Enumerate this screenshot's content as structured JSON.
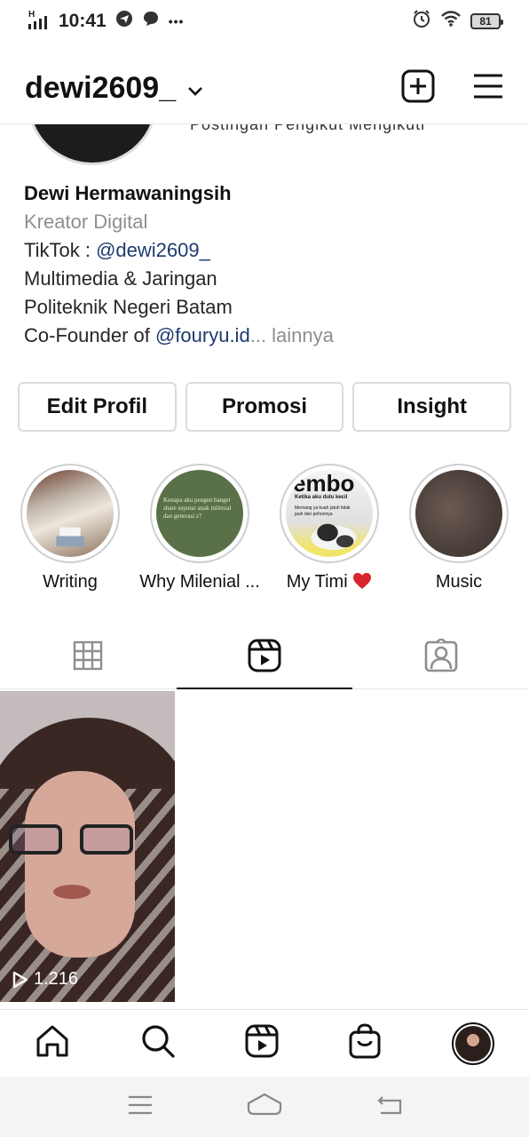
{
  "status_bar": {
    "time": "10:41",
    "dots": "•••",
    "battery": "81",
    "icons": [
      "signal-icon",
      "telegram-icon",
      "chat-bubble-icon",
      "alarm-icon",
      "wifi-icon",
      "battery-icon"
    ]
  },
  "header": {
    "username": "dewi2609_",
    "icons": [
      "chevron-down-icon",
      "new-post-icon",
      "menu-icon"
    ]
  },
  "profile": {
    "stats_partial": "Postingan    Pengikut    Mengikuti",
    "name": "Dewi Hermawaningsih",
    "category": "Kreator Digital",
    "bio_tiktok_prefix": "TikTok : ",
    "bio_tiktok_handle": "@dewi2609_",
    "bio_line2": "Multimedia & Jaringan",
    "bio_line3": "Politeknik Negeri Batam",
    "bio_cofounder_prefix": "Co-Founder of ",
    "bio_cofounder_handle": "@fouryu.id",
    "bio_ellipsis": "...",
    "more_label": "lainnya"
  },
  "actions": {
    "edit": "Edit Profil",
    "promo": "Promosi",
    "insight": "Insight"
  },
  "highlights": [
    {
      "label": "Writing"
    },
    {
      "label": "Why Milenial ...",
      "cover_text": "Kenapa aku pengen banget share seputar anak milenial dan generasi z?"
    },
    {
      "label": "My Timi",
      "cover_top": "embo",
      "cover_sub": "Ketika aku dulu kecil",
      "cover_body": "Memang ya kuah jatuh tidak jauh dari pohonnya"
    },
    {
      "label": "Music"
    }
  ],
  "tabs": [
    "grid-icon",
    "reels-icon",
    "tagged-icon"
  ],
  "reel": {
    "views": "1.216"
  },
  "bottom_nav": [
    "home-icon",
    "search-icon",
    "reels-icon",
    "shop-icon",
    "profile-avatar"
  ],
  "system_nav": [
    "recents-icon",
    "home-icon",
    "back-icon"
  ]
}
